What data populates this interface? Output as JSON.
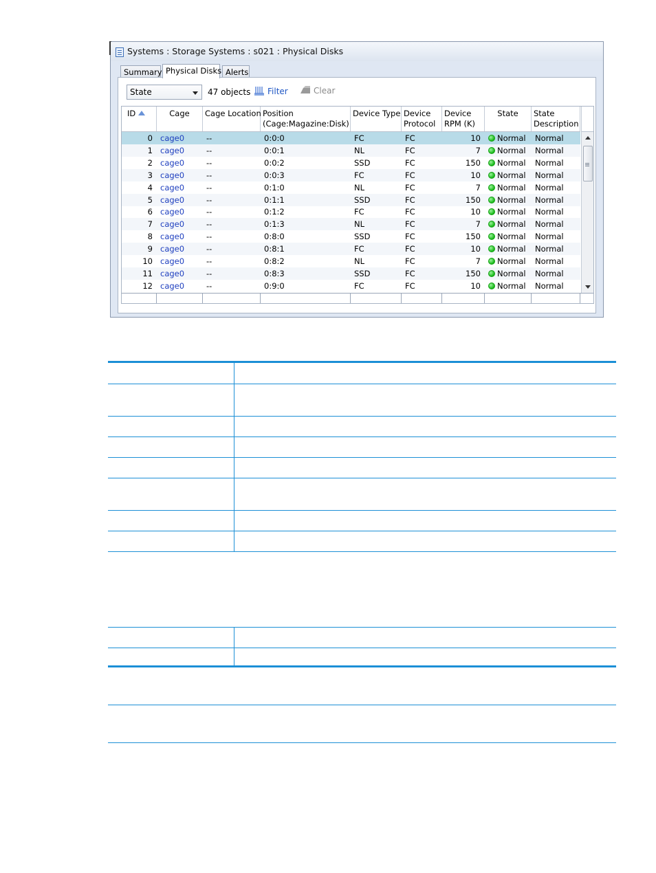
{
  "window": {
    "title": "Systems : Storage Systems : s021 : Physical Disks"
  },
  "tabs": [
    {
      "label": "Summary",
      "active": false
    },
    {
      "label": "Physical Disks",
      "active": true
    },
    {
      "label": "Alerts",
      "active": false
    }
  ],
  "toolbar": {
    "filter_select_value": "State",
    "object_count": "47 objects",
    "filter_label": "Filter",
    "clear_label": "Clear"
  },
  "grid": {
    "columns": [
      {
        "key": "id",
        "label": "ID",
        "sorted": "ascending"
      },
      {
        "key": "cage",
        "label": "Cage"
      },
      {
        "key": "cage_location",
        "label": "Cage Location"
      },
      {
        "key": "position",
        "label": "Position\n(Cage:Magazine:Disk)"
      },
      {
        "key": "device_type",
        "label": "Device Type"
      },
      {
        "key": "device_protocol",
        "label": "Device\nProtocol"
      },
      {
        "key": "device_rpm",
        "label": "Device\nRPM (K)"
      },
      {
        "key": "state",
        "label": "State"
      },
      {
        "key": "state_description",
        "label": "State\nDescription"
      }
    ],
    "selected_row": 0,
    "rows": [
      {
        "id": "0",
        "cage": "cage0",
        "cage_location": "--",
        "position": "0:0:0",
        "device_type": "FC",
        "device_protocol": "FC",
        "device_rpm": "10",
        "state": "Normal",
        "state_description": "Normal"
      },
      {
        "id": "1",
        "cage": "cage0",
        "cage_location": "--",
        "position": "0:0:1",
        "device_type": "NL",
        "device_protocol": "FC",
        "device_rpm": "7",
        "state": "Normal",
        "state_description": "Normal"
      },
      {
        "id": "2",
        "cage": "cage0",
        "cage_location": "--",
        "position": "0:0:2",
        "device_type": "SSD",
        "device_protocol": "FC",
        "device_rpm": "150",
        "state": "Normal",
        "state_description": "Normal"
      },
      {
        "id": "3",
        "cage": "cage0",
        "cage_location": "--",
        "position": "0:0:3",
        "device_type": "FC",
        "device_protocol": "FC",
        "device_rpm": "10",
        "state": "Normal",
        "state_description": "Normal"
      },
      {
        "id": "4",
        "cage": "cage0",
        "cage_location": "--",
        "position": "0:1:0",
        "device_type": "NL",
        "device_protocol": "FC",
        "device_rpm": "7",
        "state": "Normal",
        "state_description": "Normal"
      },
      {
        "id": "5",
        "cage": "cage0",
        "cage_location": "--",
        "position": "0:1:1",
        "device_type": "SSD",
        "device_protocol": "FC",
        "device_rpm": "150",
        "state": "Normal",
        "state_description": "Normal"
      },
      {
        "id": "6",
        "cage": "cage0",
        "cage_location": "--",
        "position": "0:1:2",
        "device_type": "FC",
        "device_protocol": "FC",
        "device_rpm": "10",
        "state": "Normal",
        "state_description": "Normal"
      },
      {
        "id": "7",
        "cage": "cage0",
        "cage_location": "--",
        "position": "0:1:3",
        "device_type": "NL",
        "device_protocol": "FC",
        "device_rpm": "7",
        "state": "Normal",
        "state_description": "Normal"
      },
      {
        "id": "8",
        "cage": "cage0",
        "cage_location": "--",
        "position": "0:8:0",
        "device_type": "SSD",
        "device_protocol": "FC",
        "device_rpm": "150",
        "state": "Normal",
        "state_description": "Normal"
      },
      {
        "id": "9",
        "cage": "cage0",
        "cage_location": "--",
        "position": "0:8:1",
        "device_type": "FC",
        "device_protocol": "FC",
        "device_rpm": "10",
        "state": "Normal",
        "state_description": "Normal"
      },
      {
        "id": "10",
        "cage": "cage0",
        "cage_location": "--",
        "position": "0:8:2",
        "device_type": "NL",
        "device_protocol": "FC",
        "device_rpm": "7",
        "state": "Normal",
        "state_description": "Normal"
      },
      {
        "id": "11",
        "cage": "cage0",
        "cage_location": "--",
        "position": "0:8:3",
        "device_type": "SSD",
        "device_protocol": "FC",
        "device_rpm": "150",
        "state": "Normal",
        "state_description": "Normal"
      },
      {
        "id": "12",
        "cage": "cage0",
        "cage_location": "--",
        "position": "0:9:0",
        "device_type": "FC",
        "device_protocol": "FC",
        "device_rpm": "10",
        "state": "Normal",
        "state_description": "Normal"
      }
    ]
  },
  "colors": {
    "selected_row": "#b8dbe8",
    "link": "#1e3fbf",
    "status_normal": "#17b817",
    "doc_rule": "#1b8fd6"
  },
  "icons": {
    "window": "document-list-icon",
    "filter": "filter-icon",
    "clear": "eraser-icon",
    "state_ok": "green-status-dot-icon"
  }
}
